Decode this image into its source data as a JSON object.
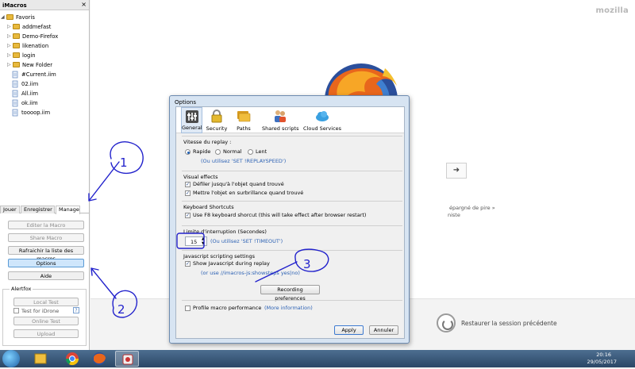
{
  "sidebar": {
    "title": "iMacros",
    "close_glyph": "×",
    "root_label": "Favoris",
    "folders": [
      "addmefast",
      "Demo-Firefox",
      "likenation",
      "login",
      "New Folder"
    ],
    "files": [
      "#Current.iim",
      "02.iim",
      "All.iim",
      "ok.iim",
      "toooop.iim"
    ],
    "tabs": [
      "Jouer",
      "Enregistrer",
      "Manage"
    ],
    "active_tab": "Manage",
    "buttons": {
      "edit": "Editer la Macro",
      "share": "Share Macro",
      "refresh": "Rafraichir la liste des macros",
      "options": "Options",
      "help": "Aide"
    },
    "alertfox": {
      "title": "Alertfox",
      "local_test": "Local Test",
      "idrone_label": "Test for iDrone",
      "help_glyph": "?",
      "online_test": "Online Test",
      "upload": "Upload"
    }
  },
  "browser": {
    "brand": "mozilla",
    "search_go_glyph": "➜",
    "snippet_line1": "épargné de pire »",
    "snippet_line2": "niste",
    "restore_label": "Restaurer la session précédente"
  },
  "dialog": {
    "title": "Options",
    "toolbar": [
      {
        "label": "General",
        "icon": "general-icon",
        "selected": true
      },
      {
        "label": "Security",
        "icon": "lock-icon",
        "selected": false
      },
      {
        "label": "Paths",
        "icon": "folders-icon",
        "selected": false
      },
      {
        "label": "Shared scripts",
        "icon": "users-icon",
        "selected": false
      },
      {
        "label": "Cloud Services",
        "icon": "cloud-icon",
        "selected": false
      }
    ],
    "replay_speed": {
      "title": "Vitesse du replay :",
      "options": [
        "Rapide",
        "Normal",
        "Lent"
      ],
      "selected": "Rapide",
      "hint": "(Ou utilisez 'SET !REPLAYSPEED')"
    },
    "visual_effects": {
      "title": "Visual effects",
      "scroll": "Défiler jusqu'à l'objet quand trouvé",
      "highlight": "Mettre l'objet en surbrillance quand trouvé"
    },
    "shortcuts": {
      "title": "Keyboard Shortcuts",
      "f8": "Use F8 keyboard shorcut (this will take effect after browser restart)"
    },
    "timeout": {
      "title": "Limite d'interruption (Secondes)",
      "value": "15",
      "hint": "(Ou utilisez 'SET !TIMEOUT')"
    },
    "js": {
      "title": "Javascript scripting settings",
      "show": "Show Javascript during replay",
      "hint": "(or use //imacros-js:showsteps yes|no)"
    },
    "recording_btn": "Recording preferences",
    "profile": {
      "label": "Profile macro performance",
      "more": "(More information)"
    },
    "apply": "Apply",
    "cancel": "Annuler"
  },
  "annotations": {
    "n1": "1",
    "n2": "2",
    "n3": "3",
    "color": "#2222cc"
  },
  "taskbar": {
    "time": "20:16",
    "date": "29/05/2017"
  }
}
